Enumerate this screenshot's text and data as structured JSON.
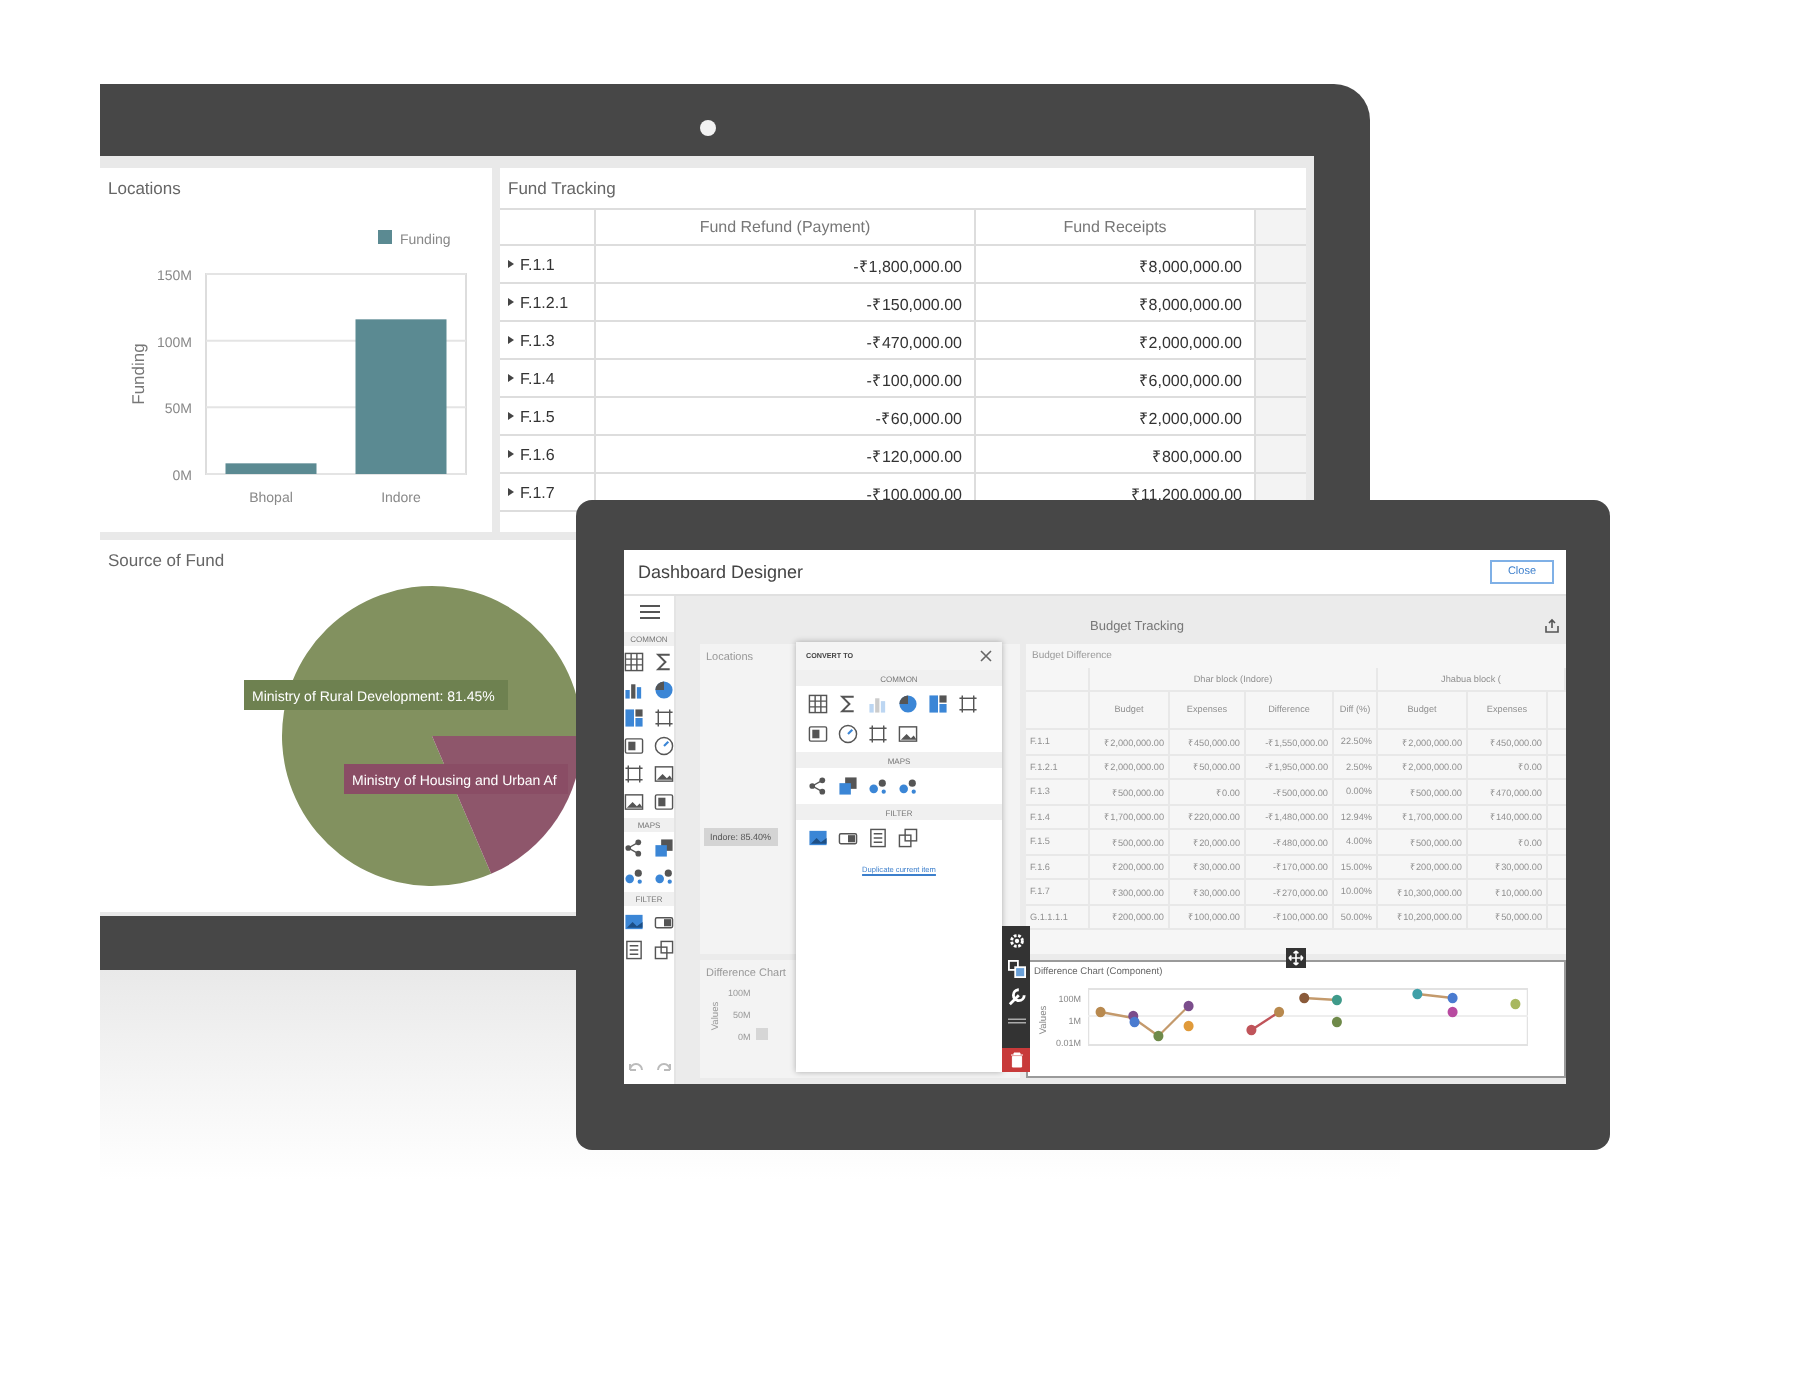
{
  "laptop": {
    "locations": {
      "title": "Locations",
      "chart_data": {
        "type": "bar",
        "ylabel": "Funding",
        "categories": [
          "Bhopal",
          "Indore"
        ],
        "series": [
          {
            "name": "Funding",
            "color": "#5b8a92",
            "values": [
              8000000,
              116000000
            ]
          }
        ],
        "ylim": [
          0,
          150000000
        ],
        "yticks": [
          {
            "value": 0,
            "label": "0M"
          },
          {
            "value": 50000000,
            "label": "50M"
          },
          {
            "value": 100000000,
            "label": "100M"
          },
          {
            "value": 150000000,
            "label": "150M"
          }
        ]
      }
    },
    "fund_tracking": {
      "title": "Fund Tracking",
      "columns": [
        "Fund Refund (Payment)",
        "Fund Receipts"
      ],
      "rows": [
        {
          "label": "F.1.1",
          "cells": [
            "-₹1,800,000.00",
            "₹8,000,000.00"
          ]
        },
        {
          "label": "F.1.2.1",
          "cells": [
            "-₹150,000.00",
            "₹8,000,000.00"
          ]
        },
        {
          "label": "F.1.3",
          "cells": [
            "-₹470,000.00",
            "₹2,000,000.00"
          ]
        },
        {
          "label": "F.1.4",
          "cells": [
            "-₹100,000.00",
            "₹6,000,000.00"
          ]
        },
        {
          "label": "F.1.5",
          "cells": [
            "-₹60,000.00",
            "₹2,000,000.00"
          ]
        },
        {
          "label": "F.1.6",
          "cells": [
            "-₹120,000.00",
            "₹800,000.00"
          ]
        },
        {
          "label": "F.1.7",
          "cells": [
            "-₹100,000.00",
            "₹11,200,000.00"
          ]
        }
      ]
    },
    "source_of_fund": {
      "title": "Source of Fund",
      "chart_data": {
        "type": "pie",
        "values": [
          81.45,
          18.55
        ],
        "annotations": [
          "Ministry of Rural Development: 81.45%",
          "Ministry of Housing and Urban Af"
        ]
      }
    }
  },
  "designer": {
    "title": "Dashboard Designer",
    "close_button": "Close",
    "toolbar_sections": [
      "COMMON",
      "MAPS",
      "FILTER"
    ],
    "dashboard_title": "Budget Tracking",
    "background_items": {
      "locations_title": "Locations",
      "pie_label": "Indore: 85.40%",
      "chart_title": "Difference Chart",
      "yticks": [
        "100M",
        "50M",
        "0M"
      ],
      "ylabel": "Values"
    },
    "convert_to": {
      "title": "CONVERT TO",
      "sections": [
        "COMMON",
        "MAPS",
        "FILTER"
      ],
      "link": "Duplicate current item"
    },
    "budget": {
      "title": "Budget Difference",
      "groups": [
        "Dhar block (Indore)",
        "Jhabua block ("
      ],
      "columns": [
        "Budget",
        "Expenses",
        "Difference",
        "Diff (%)",
        "Budget",
        "Expenses"
      ],
      "rows": [
        {
          "label": "F.1.1",
          "cells": [
            "₹2,000,000.00",
            "₹450,000.00",
            "-₹1,550,000.00",
            "22.50%",
            "₹2,000,000.00",
            "₹450,000.00"
          ]
        },
        {
          "label": "F.1.2.1",
          "cells": [
            "₹2,000,000.00",
            "₹50,000.00",
            "-₹1,950,000.00",
            "2.50%",
            "₹2,000,000.00",
            "₹0.00"
          ]
        },
        {
          "label": "F.1.3",
          "cells": [
            "₹500,000.00",
            "₹0.00",
            "-₹500,000.00",
            "0.00%",
            "₹500,000.00",
            "₹470,000.00"
          ]
        },
        {
          "label": "F.1.4",
          "cells": [
            "₹1,700,000.00",
            "₹220,000.00",
            "-₹1,480,000.00",
            "12.94%",
            "₹1,700,000.00",
            "₹140,000.00"
          ]
        },
        {
          "label": "F.1.5",
          "cells": [
            "₹500,000.00",
            "₹20,000.00",
            "-₹480,000.00",
            "4.00%",
            "₹500,000.00",
            "₹0.00"
          ]
        },
        {
          "label": "F.1.6",
          "cells": [
            "₹200,000.00",
            "₹30,000.00",
            "-₹170,000.00",
            "15.00%",
            "₹200,000.00",
            "₹30,000.00"
          ]
        },
        {
          "label": "F.1.7",
          "cells": [
            "₹300,000.00",
            "₹30,000.00",
            "-₹270,000.00",
            "10.00%",
            "₹10,300,000.00",
            "₹10,000.00"
          ]
        },
        {
          "label": "G.1.1.1.1",
          "cells": [
            "₹200,000.00",
            "₹100,000.00",
            "-₹100,000.00",
            "50.00%",
            "₹10,200,000.00",
            "₹50,000.00"
          ]
        }
      ]
    },
    "difference_chart": {
      "title": "Difference Chart (Component)",
      "ylabel": "Values",
      "yticks": [
        "100M",
        "1M",
        "0.01M"
      ]
    }
  }
}
